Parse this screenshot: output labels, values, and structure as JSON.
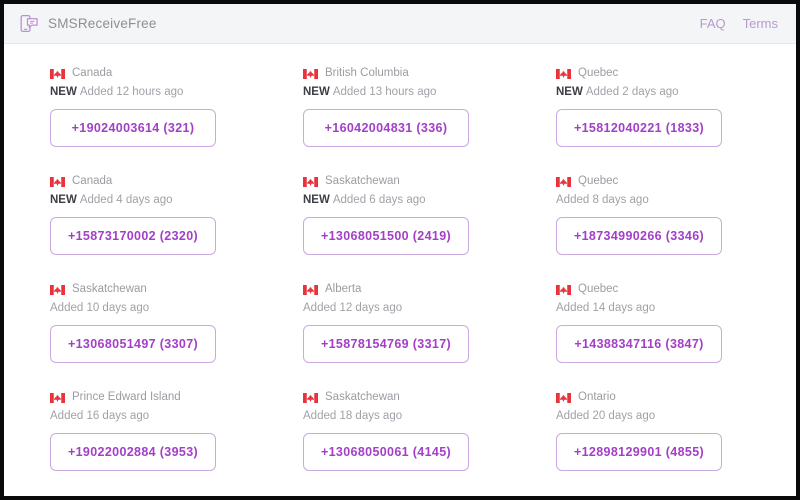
{
  "header": {
    "logo_icon": "phone-message-icon",
    "brand": "SMSReceiveFree",
    "nav": [
      {
        "label": "FAQ",
        "name": "faq"
      },
      {
        "label": "Terms",
        "name": "terms"
      }
    ]
  },
  "colors": {
    "accent_purple": "#a33fc7",
    "box_border": "#cbaadf",
    "nav_link": "#b89ad0",
    "muted_text": "#9a9ca1",
    "header_bg": "#f4f5f7",
    "flag_red": "#e8323c",
    "frame": "#0a0a0a"
  },
  "badge_new_label": "NEW",
  "cards": [
    {
      "flag_icon": "canada-flag-icon",
      "location": "Canada",
      "is_new": true,
      "added": "Added 12 hours ago",
      "number": "+19024003614 (321)"
    },
    {
      "flag_icon": "canada-flag-icon",
      "location": "British Columbia",
      "is_new": true,
      "added": "Added 13 hours ago",
      "number": "+16042004831 (336)"
    },
    {
      "flag_icon": "canada-flag-icon",
      "location": "Quebec",
      "is_new": true,
      "added": "Added 2 days ago",
      "number": "+15812040221 (1833)"
    },
    {
      "flag_icon": "canada-flag-icon",
      "location": "Canada",
      "is_new": true,
      "added": "Added 4 days ago",
      "number": "+15873170002 (2320)"
    },
    {
      "flag_icon": "canada-flag-icon",
      "location": "Saskatchewan",
      "is_new": true,
      "added": "Added 6 days ago",
      "number": "+13068051500 (2419)"
    },
    {
      "flag_icon": "canada-flag-icon",
      "location": "Quebec",
      "is_new": false,
      "added": "Added 8 days ago",
      "number": "+18734990266 (3346)"
    },
    {
      "flag_icon": "canada-flag-icon",
      "location": "Saskatchewan",
      "is_new": false,
      "added": "Added 10 days ago",
      "number": "+13068051497 (3307)"
    },
    {
      "flag_icon": "canada-flag-icon",
      "location": "Alberta",
      "is_new": false,
      "added": "Added 12 days ago",
      "number": "+15878154769 (3317)"
    },
    {
      "flag_icon": "canada-flag-icon",
      "location": "Quebec",
      "is_new": false,
      "added": "Added 14 days ago",
      "number": "+14388347116 (3847)"
    },
    {
      "flag_icon": "canada-flag-icon",
      "location": "Prince Edward Island",
      "is_new": false,
      "added": "Added 16 days ago",
      "number": "+19022002884 (3953)"
    },
    {
      "flag_icon": "canada-flag-icon",
      "location": "Saskatchewan",
      "is_new": false,
      "added": "Added 18 days ago",
      "number": "+13068050061 (4145)"
    },
    {
      "flag_icon": "canada-flag-icon",
      "location": "Ontario",
      "is_new": false,
      "added": "Added 20 days ago",
      "number": "+12898129901 (4855)"
    }
  ]
}
